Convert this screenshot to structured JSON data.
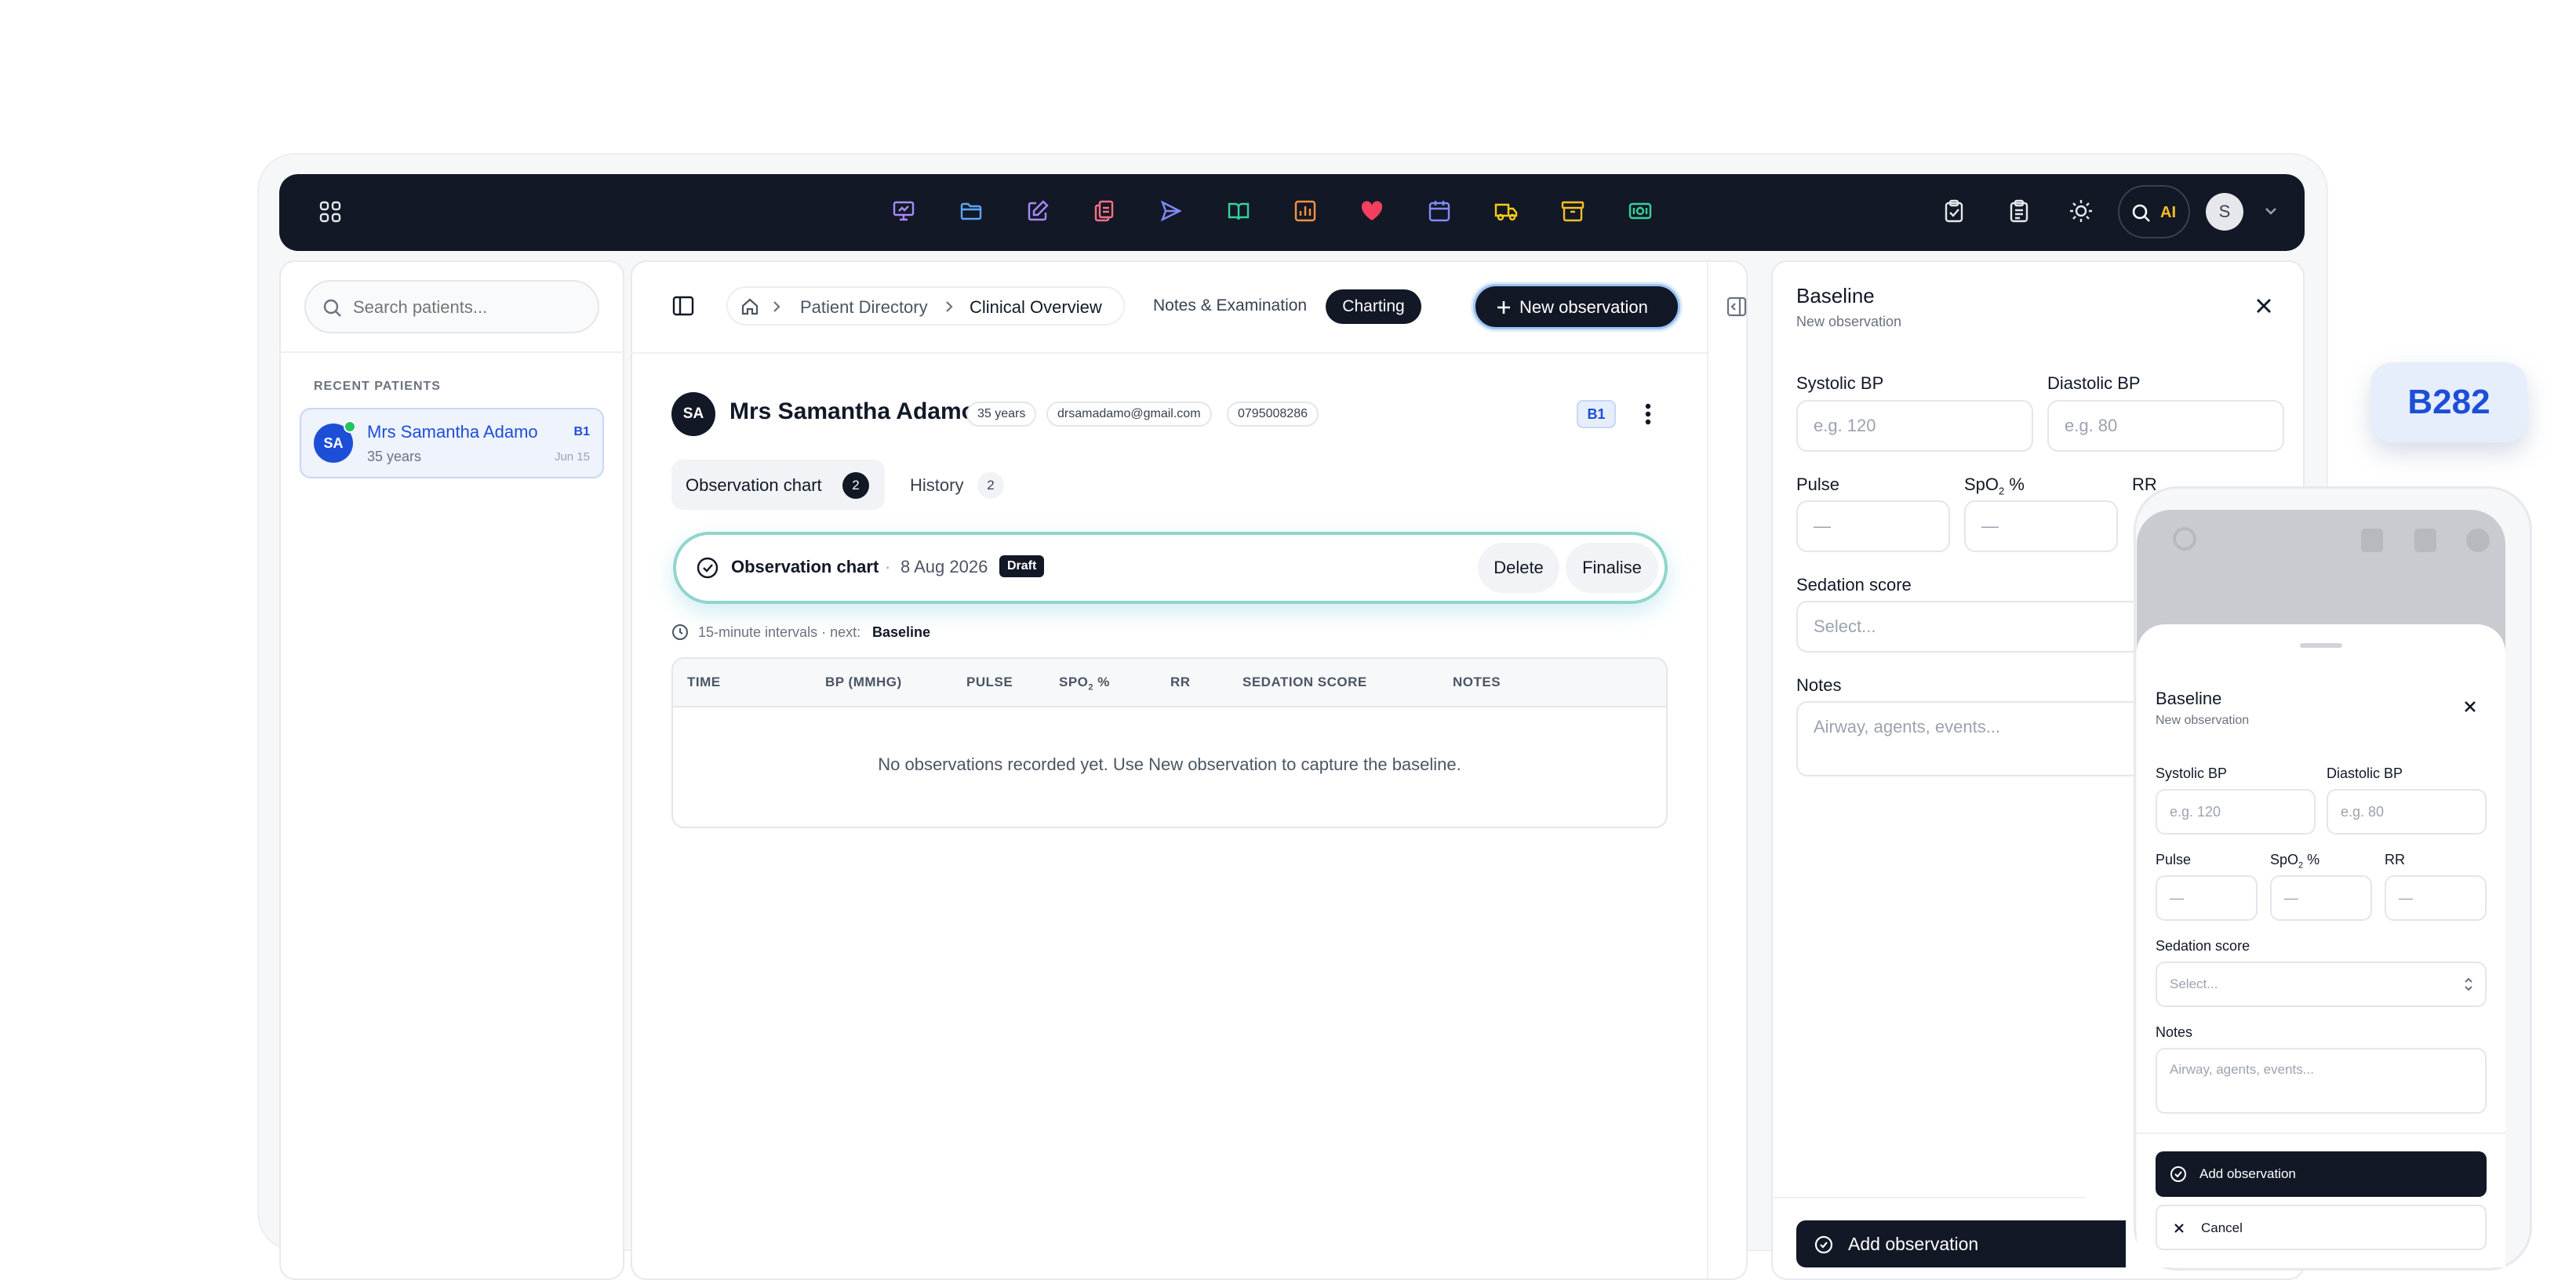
{
  "topbar": {
    "ai_label": "AI",
    "avatar_initial": "S"
  },
  "sidebar": {
    "search_placeholder": "Search patients...",
    "recent_label": "RECENT PATIENTS",
    "patient": {
      "initials": "SA",
      "name": "Mrs Samantha Adamo",
      "age": "35 years",
      "bed": "B1",
      "date": "Jun 15"
    }
  },
  "breadcrumb": {
    "item1": "Patient Directory",
    "item2": "Clinical Overview"
  },
  "nav_tabs": {
    "notes": "Notes & Examination",
    "charting": "Charting"
  },
  "new_observation_label": "New observation",
  "patient_header": {
    "initials": "SA",
    "name": "Mrs Samantha Adamo",
    "age": "35 years",
    "email": "drsamadamo@gmail.com",
    "phone": "0795008286",
    "bed": "B1"
  },
  "subtabs": {
    "observation_chart": "Observation chart",
    "observation_count": "2",
    "history": "History",
    "history_count": "2"
  },
  "chart_card": {
    "title": "Observation chart",
    "date": "8 Aug 2026",
    "status": "Draft",
    "delete": "Delete",
    "finalise": "Finalise"
  },
  "interval": {
    "text": "15-minute intervals · next:",
    "next": "Baseline"
  },
  "table": {
    "headers": [
      "TIME",
      "BP (MMHG)",
      "PULSE",
      "SPO",
      "RR",
      "SEDATION SCORE",
      "NOTES"
    ],
    "spo_sub": "2",
    "spo_suffix": " %",
    "empty": "No observations recorded yet. Use New observation to capture the baseline."
  },
  "form": {
    "title": "Baseline",
    "subtitle": "New observation",
    "systolic_label": "Systolic BP",
    "systolic_placeholder": "e.g. 120",
    "diastolic_label": "Diastolic BP",
    "diastolic_placeholder": "e.g. 80",
    "pulse_label": "Pulse",
    "spo_label": "SpO",
    "spo_sub": "2",
    "spo_suffix": " %",
    "rr_label": "RR",
    "dash": "—",
    "sedation_label": "Sedation score",
    "sedation_placeholder": "Select...",
    "notes_label": "Notes",
    "notes_placeholder": "Airway, agents, events...",
    "add_label": "Add observation",
    "cancel_label": "Cancel"
  },
  "floating_badge": "B282",
  "colors": {
    "dark": "#121826",
    "accent": "#1d4ed8",
    "online": "#22c55e",
    "badge_bg": "#e6eefc"
  }
}
